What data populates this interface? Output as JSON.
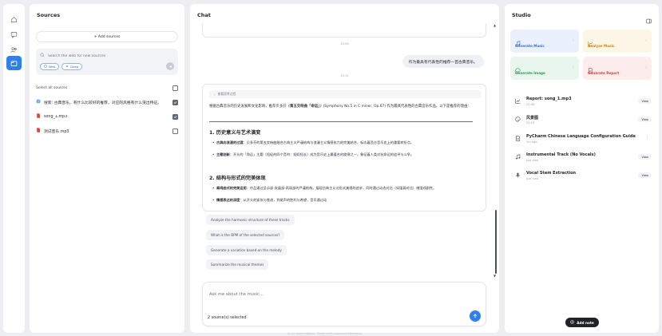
{
  "sources": {
    "title": "Sources",
    "add_label": "+ Add sources",
    "search_placeholder": "Search the web for new sources",
    "chip_web": "Web",
    "chip_deep": "Deep",
    "select_all": "Select all sources",
    "items": [
      {
        "label": "搜索: 古典音乐，有什么比较好的推荐，对应的风格有什么突出特征。",
        "checked": true,
        "icon": "globe-icon"
      },
      {
        "label": "song_1.mp3",
        "checked": true,
        "icon": "file-icon"
      },
      {
        "label": "测试音乐.mp3",
        "checked": false,
        "icon": "file-icon"
      }
    ]
  },
  "chat": {
    "title": "Chat",
    "ts1": "22:04",
    "user_msg": "作为最具有代表性的推荐一首古典音乐。",
    "ts2": "22:11",
    "ref_label": "查看思考过程",
    "intro_a": "根据古典音乐的历史发展和文化影响，推荐贝多芬《",
    "intro_b": "第五交响曲「命运」",
    "intro_c": "》(Symphony No.5 in C minor, Op.67) 作为最具代表性的古典音乐作品。以下是推荐的理由：",
    "h1": "1. 历史意义与艺术演变",
    "b1_t": "古典向浪漫的过渡",
    "b1_d": "：贝多芬的第五交响曲融合古典主义严谨结构与浪漫主义情感张力的完美结合，标志着西方音乐史上的重要转折点。",
    "b2_t": "主题创新",
    "b2_d": "：开头的「命运」主题（短促的四个音符：短短短长）成为音乐史上最著名的旋律之一，象征着人类对抗命运的追寻与斗争。",
    "h2": "2. 结构与形式的完美体现",
    "b3_t": "奏鸣曲式的完美运用",
    "b3_d": "：作品通过呈示部-发展部-再现部的严谨结构，展现古典主义对形式美感的追求，同时通过动态对比（如强弱对比）增强戏剧性。",
    "b4_t": "情感表达的深度",
    "b4_d": "：从开头的紧张与焦虑，到尾声的胜利与希望，音乐通过动",
    "suggestions": [
      "Analyze the harmonic structure of these tracks",
      "What is the BPM of the selected sources?",
      "Generate a variation based on the melody",
      "Summarize the musical themes"
    ],
    "input_placeholder": "Ask me about the music...",
    "selected_status": "2 source(s) selected",
    "footer": "AI can make mistakes. Please verify important information."
  },
  "studio": {
    "title": "Studio",
    "tiles": [
      {
        "label": "Generate Music",
        "color": "#3b6fd8",
        "bg": "#eaf0fc"
      },
      {
        "label": "Analyze Music",
        "color": "#c28a1e",
        "bg": "#fdf5e6"
      },
      {
        "label": "Generate Image",
        "color": "#2f9a5a",
        "bg": "#e9f6ee"
      },
      {
        "label": "Generate Report",
        "color": "#d2453c",
        "bg": "#fcecec"
      }
    ],
    "notes": [
      {
        "title": "Report: song_1.mp3",
        "sub": "22:08",
        "action": "View"
      },
      {
        "title": "风景图",
        "sub": "22:15",
        "action": "View"
      },
      {
        "title": "PyCharm Chinese Language Configuration Guide",
        "sub": "3m ago",
        "action": ""
      },
      {
        "title": "Instrumental Track (No Vocals)",
        "sub": "Just now",
        "action": "View"
      },
      {
        "title": "Vocal Stem Extraction",
        "sub": "Just now",
        "action": "View"
      }
    ],
    "add_note": "Add note"
  }
}
